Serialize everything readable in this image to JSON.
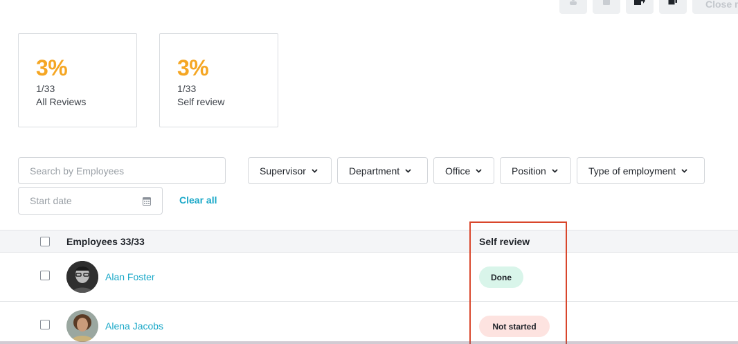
{
  "toolbar": {
    "buttons": [
      {
        "name": "person-icon"
      },
      {
        "name": "trash-icon"
      },
      {
        "name": "export-icon"
      },
      {
        "name": "copy-icon"
      }
    ],
    "close_label": "Close r"
  },
  "stats": [
    {
      "percent": "3%",
      "fraction": "1/33",
      "label": "All Reviews"
    },
    {
      "percent": "3%",
      "fraction": "1/33",
      "label": "Self review"
    }
  ],
  "filters": {
    "search_placeholder": "Search by Employees",
    "date_placeholder": "Start date",
    "clear_all": "Clear all",
    "dropdowns": [
      "Supervisor",
      "Department",
      "Office",
      "Position",
      "Type of employment"
    ]
  },
  "table": {
    "col_employees": "Employees 33/33",
    "col_self_review": "Self review",
    "rows": [
      {
        "name": "Alan Foster",
        "status": "Done"
      },
      {
        "name": "Alena Jacobs",
        "status": "Not started"
      }
    ]
  },
  "colors": {
    "accent_orange": "#f5a623",
    "link_blue": "#1aa8c8",
    "highlight_red": "#d9462b",
    "done_bg": "#d9f5ea",
    "not_started_bg": "#fde3e0"
  }
}
